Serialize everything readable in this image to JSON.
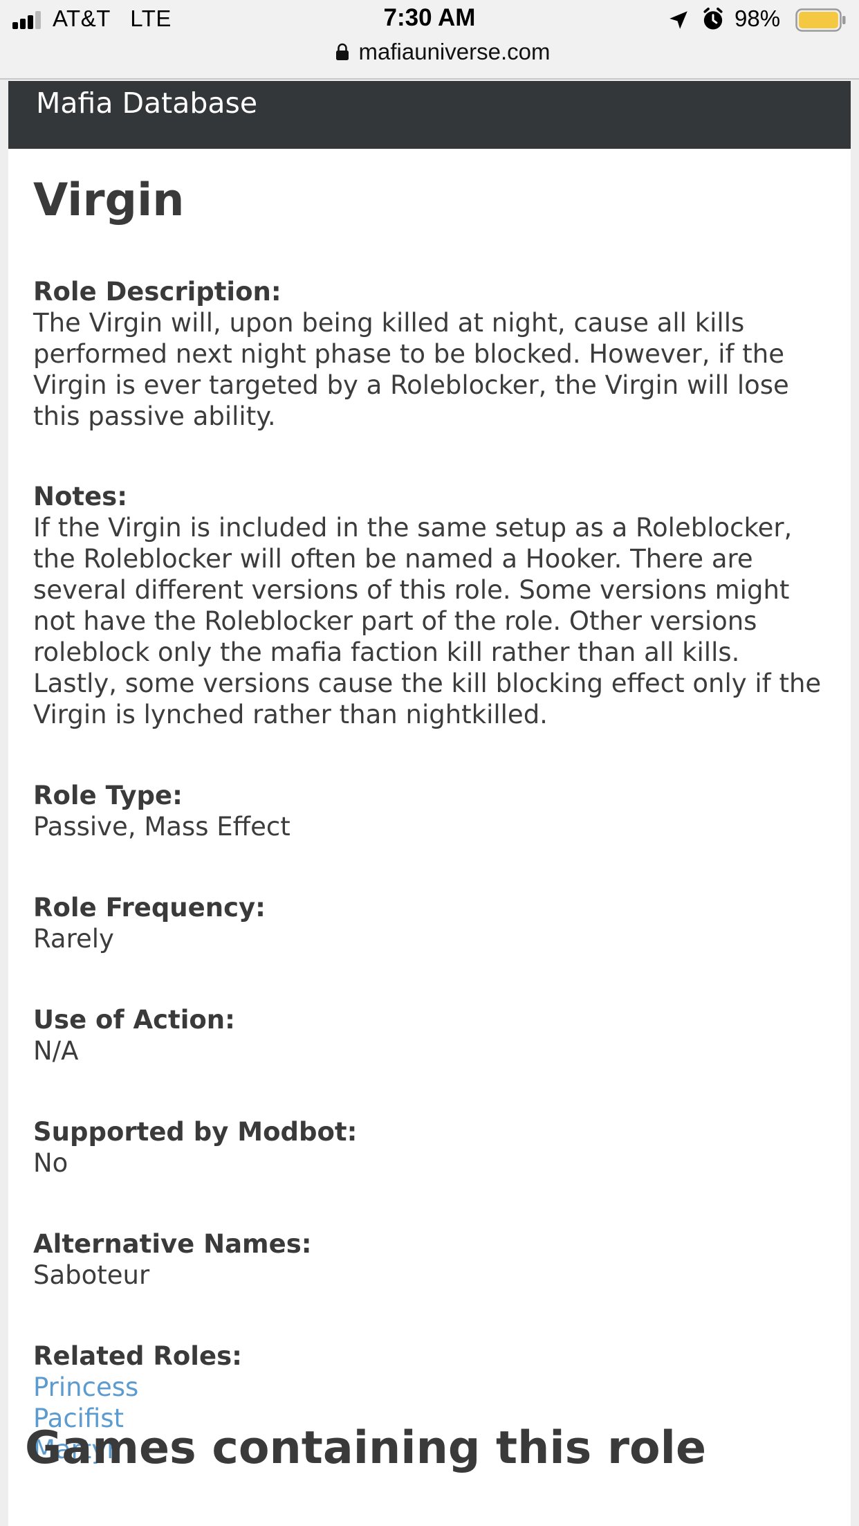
{
  "status_bar": {
    "carrier": "AT&T   LTE",
    "time": "7:30 AM",
    "battery_percent": "98%",
    "battery_level": 0.98,
    "url": "mafiauniverse.com"
  },
  "header": {
    "site_title": "Mafia Database"
  },
  "page": {
    "title": "Virgin",
    "fields": [
      {
        "label": "Role Description:",
        "value": "The Virgin will, upon being killed at night, cause all kills performed next night phase to be blocked. However, if the Virgin is ever targeted by a Roleblocker, the Virgin will lose this passive ability."
      },
      {
        "label": "Notes:",
        "value": "If the Virgin is included in the same setup as a Roleblocker, the Roleblocker will often be named a Hooker. There are several different versions of this role. Some versions might not have the Roleblocker part of the role. Other versions roleblock only the mafia faction kill rather than all kills. Lastly, some versions cause the kill blocking effect only if the Virgin is lynched rather than nightkilled."
      },
      {
        "label": "Role Type:",
        "value": "Passive, Mass Effect"
      },
      {
        "label": "Role Frequency:",
        "value": "Rarely"
      },
      {
        "label": "Use of Action:",
        "value": "N/A"
      },
      {
        "label": "Supported by Modbot:",
        "value": "No"
      },
      {
        "label": "Alternative Names:",
        "value": "Saboteur"
      }
    ],
    "related_roles_label": "Related Roles:",
    "related_roles": [
      "Princess",
      "Pacifist",
      "Martyr"
    ],
    "next_section_heading": "Games containing this role"
  },
  "colors": {
    "header_bg": "#33373a",
    "link": "#5b9bd0",
    "battery_fill": "#f5c842"
  },
  "icons": [
    "signal-icon",
    "location-arrow-icon",
    "alarm-clock-icon",
    "battery-icon",
    "lock-icon"
  ]
}
